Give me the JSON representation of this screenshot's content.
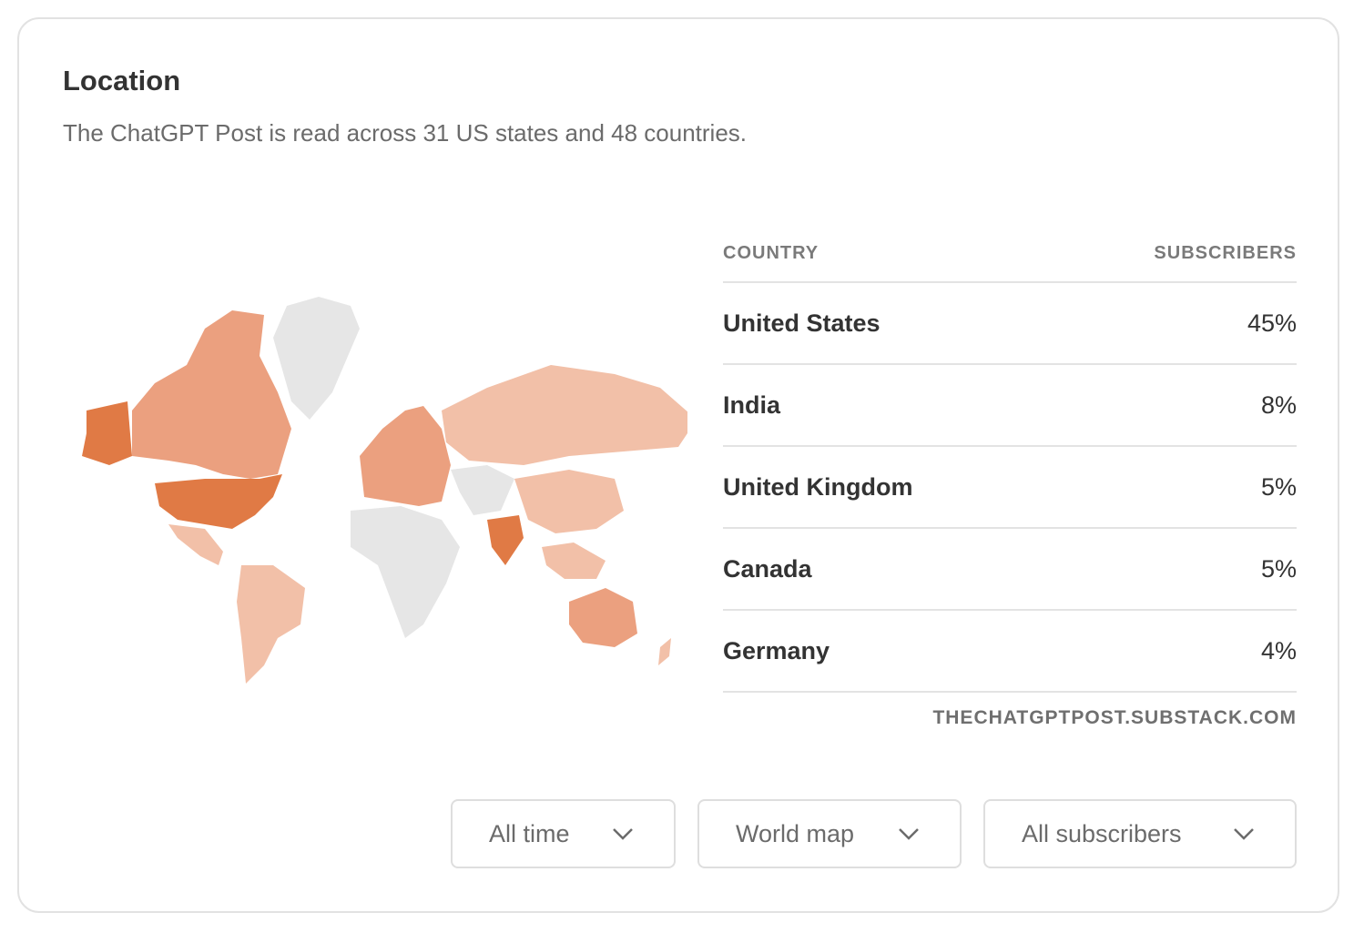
{
  "header": {
    "title": "Location",
    "subtitle": "The ChatGPT Post is read across 31 US states and 48 countries."
  },
  "table": {
    "col_country": "COUNTRY",
    "col_subscribers": "SUBSCRIBERS",
    "rows": [
      {
        "country": "United States",
        "value": "45%"
      },
      {
        "country": "India",
        "value": "8%"
      },
      {
        "country": "United Kingdom",
        "value": "5%"
      },
      {
        "country": "Canada",
        "value": "5%"
      },
      {
        "country": "Germany",
        "value": "4%"
      }
    ],
    "source": "THECHATGPTPOST.SUBSTACK.COM"
  },
  "filters": {
    "time": "All time",
    "view": "World map",
    "audience": "All subscribers"
  },
  "colors": {
    "heat_high": "#e07a45",
    "heat_mid": "#eba07f",
    "heat_low": "#f2c0a8",
    "no_data": "#e6e6e6"
  },
  "icons": {
    "dropdown": "chevron-down-icon"
  }
}
